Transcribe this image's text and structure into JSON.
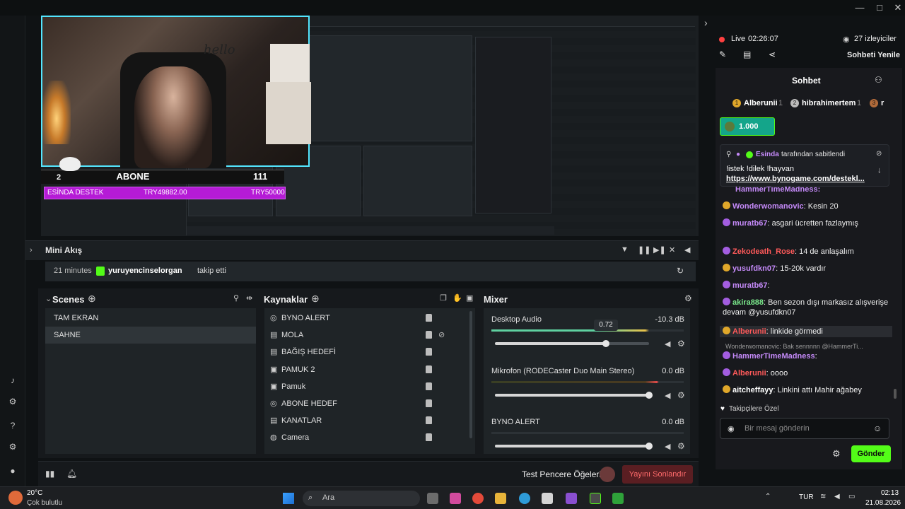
{
  "window": {
    "controls": [
      "—",
      "□",
      "✕"
    ]
  },
  "stream": {
    "status": "Live",
    "uptime": "02:26:07",
    "viewers": "27 izleyiciler",
    "refresh_chat": "Sohbeti Yenile"
  },
  "overlay": {
    "hello_text": "hello",
    "sub_count_small": "2",
    "abone_label": "ABONE",
    "abone_count": "111",
    "goal_left": "ESİNDA DESTEK",
    "goal_mid": "TRY49882.00",
    "goal_right": "TRY50000"
  },
  "mini_akis": {
    "title": "Mini Akış",
    "event_time": "21 minutes",
    "event_user": "yuruyencinselorgan",
    "event_action": "takip etti"
  },
  "scenes": {
    "title": "Scenes",
    "items": [
      "TAM EKRAN",
      "SAHNE"
    ],
    "selected_index": 1
  },
  "sources": {
    "title": "Kaynaklar",
    "items": [
      {
        "label": "BYNO ALERT",
        "icon": "globe-icon"
      },
      {
        "label": "MOLA",
        "icon": "file-icon"
      },
      {
        "label": "BAĞIŞ HEDEFİ",
        "icon": "file-icon"
      },
      {
        "label": "PAMUK 2",
        "icon": "image-icon"
      },
      {
        "label": "Pamuk",
        "icon": "image-icon"
      },
      {
        "label": "ABONE HEDEF",
        "icon": "globe-icon"
      },
      {
        "label": "KANATLAR",
        "icon": "file-icon"
      },
      {
        "label": "Camera",
        "icon": "camera-icon"
      }
    ]
  },
  "mixer": {
    "title": "Mixer",
    "channels": [
      {
        "name": "Desktop Audio",
        "db": "-10.3 dB",
        "tooltip": "0.72",
        "level": 0.72
      },
      {
        "name": "Mikrofon (RODECaster Duo Main Stereo)",
        "db": "0.0 dB",
        "level": 1.0
      },
      {
        "name": "BYNO ALERT",
        "db": "0.0 dB",
        "level": 1.0
      }
    ]
  },
  "footer": {
    "test_label": "Test Pencere Öğeleri",
    "end_stream": "Yayını Sonlandır"
  },
  "chat": {
    "title": "Sohbet",
    "leaderboard": [
      {
        "rank": "1",
        "name": "Alberunii",
        "count": "1"
      },
      {
        "rank": "2",
        "name": "hibrahimertem",
        "count": "1"
      },
      {
        "rank": "3",
        "name": "r",
        "count": ""
      }
    ],
    "gift_amount": "1.000",
    "pinned_by": "Esinda",
    "pinned_by_suffix": "tarafından sabitlendi",
    "pinned_text": "!istek !dilek !hayvan",
    "pinned_link": "https://www.bynogame.com/destekl...",
    "partial_user": "HammerTimeMadness:",
    "messages": [
      {
        "user": "Wonderwomanovic",
        "text": ": Kesin 20",
        "color": "#c58af9"
      },
      {
        "user": "muratb67",
        "text": ": asgari ücretten fazlaymış",
        "color": "#c58af9"
      },
      {
        "user": "Zekodeath_Rose",
        "text": ": 14 de anlaşalım",
        "color": "#ff5a5a"
      },
      {
        "user": "yusufdkn07",
        "text": ": 15-20k vardır",
        "color": "#c58af9"
      },
      {
        "user": "muratb67",
        "text": ":",
        "color": "#c58af9"
      },
      {
        "user": "akira888",
        "text": ": Ben sezon dışı markasız alışverişe devam @yusufdkn07",
        "color": "#7be98c"
      },
      {
        "user": "Alberunii",
        "text": ": linkide görmedi",
        "color": "#ff5a5a"
      },
      {
        "user": "HammerTimeMadness",
        "text": ":",
        "color": "#c58af9"
      },
      {
        "user": "Alberunii",
        "text": ": oooo",
        "color": "#ff5a5a"
      },
      {
        "user": "aitcheffayy",
        "text": ": Linkini attı Mahir ağabey",
        "color": "#ffffff"
      }
    ],
    "reply_preview": "Wonderwomanovic: Bak sennnnn @HammerTi...",
    "followers_only": "Takipçilere Özel",
    "input_placeholder": "Bir mesaj gönderin",
    "send_label": "Gönder"
  },
  "taskbar": {
    "temp": "20°C",
    "weather": "Çok bulutlu",
    "search_placeholder": "Ara",
    "lang": "TUR",
    "time": "02:13",
    "date": "21.08.2026"
  },
  "colors": {
    "accent_green": "#53fc18",
    "live_red": "#ff4040",
    "goal_purple": "#b51bd6",
    "cam_border": "#53e6ff"
  }
}
